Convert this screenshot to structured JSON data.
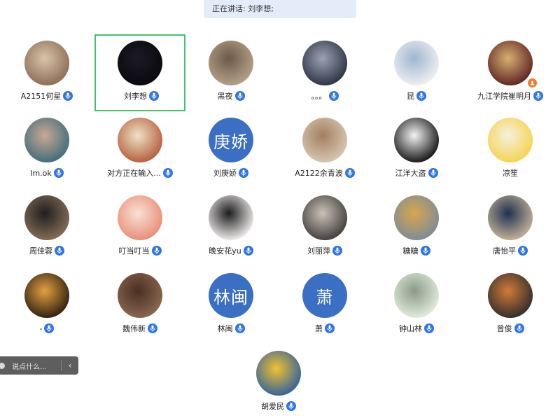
{
  "meeting": {
    "speaking_text": "正在讲话: 刘李想;"
  },
  "participants": [
    {
      "name": "A2151何星",
      "avatar": "photo-cat-glasses",
      "bg": [
        "#8a6a55",
        "#d9c3a9"
      ],
      "mic": true
    },
    {
      "name": "刘李想",
      "avatar": "photo-dark",
      "bg": [
        "#08080d",
        "#1d1a24"
      ],
      "mic": true,
      "active": true
    },
    {
      "name": "黑夜",
      "avatar": "photo-cat",
      "bg": [
        "#b9a48c",
        "#6b5a4a"
      ],
      "mic": true
    },
    {
      "name": "。。。",
      "avatar": "photo-anime-boy",
      "bg": [
        "#2a2f3e",
        "#9aa3b5"
      ],
      "mic": true
    },
    {
      "name": "昆",
      "avatar": "photo-cartoon-phone",
      "bg": [
        "#f2f2f2",
        "#9fb6d0"
      ],
      "mic": true
    },
    {
      "name": "九江学院崔明月",
      "avatar": "photo-ironman",
      "bg": [
        "#5a2020",
        "#d8b070"
      ],
      "mic": true,
      "host": true
    },
    {
      "name": "Im.ok",
      "avatar": "photo-girl",
      "bg": [
        "#3b6b7a",
        "#c9a892"
      ],
      "mic": true
    },
    {
      "name": "对方正在输入...",
      "avatar": "photo-cartoon-cat",
      "bg": [
        "#b25a3a",
        "#f0e2c6"
      ],
      "mic": true
    },
    {
      "name": "刘庚娇",
      "avatar_text": "庚娇",
      "bg": [
        "#3a6fc4",
        "#3a6fc4"
      ],
      "mic": true
    },
    {
      "name": "A2122余青波",
      "avatar": "photo-kid",
      "bg": [
        "#d9c9b5",
        "#a37f60"
      ],
      "mic": true
    },
    {
      "name": "江洋大盗",
      "avatar": "photo-lotus",
      "bg": [
        "#0e0e0e",
        "#f4f4f4"
      ],
      "mic": true
    },
    {
      "name": "凉笙",
      "avatar": "photo-yellow-hood",
      "bg": [
        "#f5d24a",
        "#f5f0e0"
      ],
      "mic": false
    },
    {
      "name": "周佳蓉",
      "avatar": "photo-panda",
      "bg": [
        "#8a705a",
        "#1e1e1e"
      ],
      "mic": true
    },
    {
      "name": "叮当叮当",
      "avatar": "photo-cartoon-food",
      "bg": [
        "#e98a73",
        "#f7e2d6"
      ],
      "mic": true
    },
    {
      "name": "晚安花yu",
      "avatar": "photo-cartoon-girl",
      "bg": [
        "#f9f5f5",
        "#1c1c1c"
      ],
      "mic": true
    },
    {
      "name": "刘丽萍",
      "avatar": "photo-dog",
      "bg": [
        "#3d3a38",
        "#c9c2b8"
      ],
      "mic": true
    },
    {
      "name": "糖糖",
      "avatar": "photo-lion-doll",
      "bg": [
        "#7b8a99",
        "#d7a64f"
      ],
      "mic": true
    },
    {
      "name": "唐怡平",
      "avatar": "photo-boy-hat",
      "bg": [
        "#c9b79a",
        "#203050"
      ],
      "mic": true
    },
    {
      "name": "-",
      "avatar": "photo-sunlight",
      "bg": [
        "#2a1c10",
        "#e3a040"
      ],
      "mic": true
    },
    {
      "name": "魏伟新",
      "avatar": "photo-teacher",
      "bg": [
        "#8c6a52",
        "#4a2e22"
      ],
      "mic": true
    },
    {
      "name": "林闽",
      "avatar_text": "林闽",
      "bg": [
        "#3a6fc4",
        "#3a6fc4"
      ],
      "mic": true
    },
    {
      "name": "萧",
      "avatar_text": "萧",
      "bg": [
        "#3a6fc4",
        "#3a6fc4"
      ],
      "mic": true
    },
    {
      "name": "钟山林",
      "avatar": "photo-dinosaur",
      "bg": [
        "#e6efdf",
        "#8a9a88"
      ],
      "mic": true
    },
    {
      "name": "曾俊",
      "avatar": "photo-basketball",
      "bg": [
        "#2b2b2b",
        "#d37a3a"
      ],
      "mic": true
    },
    {
      "name": "胡爱民",
      "avatar": "photo-sunflower",
      "bg": [
        "#2d5fa0",
        "#f2c12e"
      ],
      "mic": true
    }
  ],
  "chat": {
    "placeholder": "说点什么...",
    "toggle_label": "‹"
  },
  "colors": {
    "mic_badge": "#2f74e8",
    "active_border": "#3fc46a",
    "host_badge": "#f07a2c",
    "banner_bg": "#e4ecfa",
    "text_avatar_bg": "#3a6fc4"
  }
}
